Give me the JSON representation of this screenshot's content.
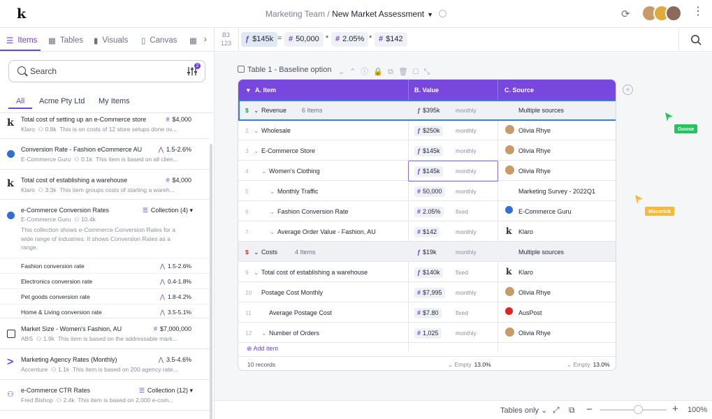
{
  "app": {
    "logo": "k"
  },
  "breadcrumb": {
    "team": "Marketing Team",
    "separator": " / ",
    "doc": "New Market Assessment"
  },
  "left_tabs": [
    {
      "label": "Items",
      "icon": "list-icon",
      "active": true
    },
    {
      "label": "Tables",
      "icon": "table-icon"
    },
    {
      "label": "Visuals",
      "icon": "bar-chart-icon"
    },
    {
      "label": "Canvas",
      "icon": "document-icon"
    }
  ],
  "search": {
    "placeholder": "Search",
    "filter_count": "2"
  },
  "filter_tabs": [
    {
      "label": "All",
      "active": true
    },
    {
      "label": "Acme Pty Ltd"
    },
    {
      "label": "My Items"
    }
  ],
  "items": [
    {
      "title": "Total cost of setting up an e-Commerce store",
      "value": "$4,000",
      "source": "Klaro",
      "users": "0.8k",
      "desc": "This is on costs of 12 store setups done ov..."
    },
    {
      "title": "Conversion Rate - Fashion eCommerce AU",
      "value": "1.5-2.6%",
      "source": "E-Commerce Guru",
      "users": "0.1k",
      "desc": "This item is based on all clien..."
    },
    {
      "title": "Total cost of establishing a warehouse",
      "value": "$4,000",
      "source": "Klaro",
      "users": "3.3k",
      "desc": "This item groups costs of starting a wareh..."
    },
    {
      "title": "e-Commerce Conversion Rates",
      "value": "Collection (4)",
      "source": "E-Commerce Guru",
      "users": "10.4k",
      "desc": "This collection shows e-Commerce Conversion Rates for a wide range of industries. It shows Conversion Rates as a range."
    },
    {
      "title": "Market Size - Women's Fashion, AU",
      "value": "$7,000,000",
      "source": "ABS",
      "users": "1.9k",
      "desc": "This item is based on the addressable mark..."
    },
    {
      "title": "Marketing Agency Rates (Monthly)",
      "value": "3.5-4.6%",
      "source": "Accenture",
      "users": "1.1k",
      "desc": "This item is based on 200 agency rate..."
    },
    {
      "title": "e-Commerce CTR Rates",
      "value": "Collection (12)",
      "source": "Fred Bishop",
      "users": "2.4k",
      "desc": "This item is based on 2,000 e-com..."
    }
  ],
  "collection_children": [
    {
      "label": "Fashion conversion rate",
      "value": "1.5-2.6%"
    },
    {
      "label": "Electronics conversion rate",
      "value": "0.4-1.8%"
    },
    {
      "label": "Pet goods conversion rate",
      "value": "1.8-4.2%"
    },
    {
      "label": "Home & Living conversion rate",
      "value": "3.5-5.1%"
    }
  ],
  "formula": {
    "cell": "B3",
    "cell_sub": "123",
    "terms": [
      "$145k",
      "50,000",
      "2.05%",
      "$142"
    ],
    "ops": [
      "=",
      "*",
      "*"
    ]
  },
  "table": {
    "title": "Table 1",
    "subtitle": " - Baseline option",
    "columns": [
      "A. Item",
      "B. Value",
      "C. Source"
    ],
    "rows": [
      {
        "num": "$",
        "label": "Revenue",
        "count": "6 Items",
        "value": "$395k",
        "period": "monthly",
        "source": "Multiple sources",
        "group": true
      },
      {
        "num": "2",
        "label": "Wholesale",
        "value": "$250k",
        "period": "monthly",
        "source": "Olivia Rhye"
      },
      {
        "num": "3",
        "label": "E-Commerce Store",
        "value": "$145k",
        "period": "monthly",
        "source": "Olivia Rhye"
      },
      {
        "num": "4",
        "label": "Women's Clothing",
        "value": "$145k",
        "period": "monthly",
        "source": "Olivia Rhye"
      },
      {
        "num": "5",
        "label": "Monthly Traffic",
        "value": "50,000",
        "period": "monthly",
        "source": "Marketing Survey - 2022Q1"
      },
      {
        "num": "6",
        "label": "Fashion Conversion Rate",
        "value": "2.05%",
        "period": "fixed",
        "source": "E-Commerce Guru"
      },
      {
        "num": "7",
        "label": "Average Order Value - Fashion, AU",
        "value": "$142",
        "period": "monthly",
        "source": "Klaro"
      },
      {
        "num": "$",
        "label": "Costs",
        "count": "4 Items",
        "value": "$19k",
        "period": "monthly",
        "source": "Multiple sources",
        "group": true
      },
      {
        "num": "9",
        "label": "Total cost of establishing a warehouse",
        "value": "$140k",
        "period": "fixed",
        "source": "Klaro"
      },
      {
        "num": "10",
        "label": "Postage Cost Monthly",
        "value": "$7,995",
        "period": "monthly",
        "source": "Olivia Rhye"
      },
      {
        "num": "11",
        "label": "Average Postage Cost",
        "value": "$7.80",
        "period": "fixed",
        "source": "AusPost"
      },
      {
        "num": "12",
        "label": "Number of Orders",
        "value": "1,025",
        "period": "monthly",
        "source": "Olivia Rhye"
      }
    ],
    "add_item": "Add item",
    "records": "10 records",
    "empty_label": "Empty",
    "empty_b": "13.0%",
    "empty_c": "13.0%"
  },
  "cursors": [
    {
      "name": "Goose",
      "color": "#22c55e"
    },
    {
      "name": "Maverick",
      "color": "#f6b93b"
    }
  ],
  "bottom": {
    "view": "Tables only",
    "zoom": "100%"
  },
  "colors": {
    "accent": "#6d43d9",
    "header": "#7747de",
    "selection": "#2f80ed"
  }
}
